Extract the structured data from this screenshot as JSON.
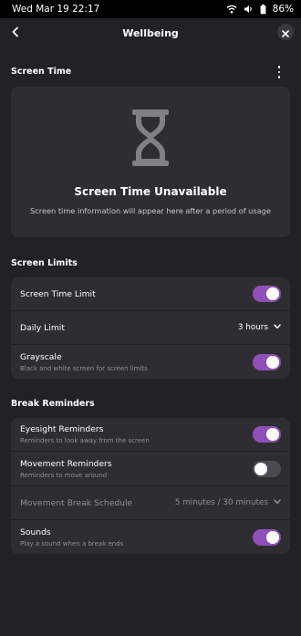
{
  "statusbar": {
    "datetime": "Wed Mar 19  22:17",
    "battery": "86%",
    "icons": [
      "wifi-icon",
      "volume-icon",
      "battery-icon"
    ]
  },
  "header": {
    "title": "Wellbeing",
    "back_icon": "chevron-left-icon",
    "close_icon": "close-icon"
  },
  "screen_time": {
    "section_title": "Screen Time",
    "menu_icon": "kebab-menu-icon",
    "placeholder_icon": "hourglass-icon",
    "placeholder_title": "Screen Time Unavailable",
    "placeholder_desc": "Screen time information will appear here after a period of usage"
  },
  "screen_limits": {
    "section_title": "Screen Limits",
    "screen_time_limit": {
      "label": "Screen Time Limit",
      "enabled": true
    },
    "daily_limit": {
      "label": "Daily Limit",
      "value": "3 hours"
    },
    "grayscale": {
      "label": "Grayscale",
      "sub": "Black and white screen for screen limits",
      "enabled": true
    }
  },
  "break_reminders": {
    "section_title": "Break Reminders",
    "eyesight": {
      "label": "Eyesight Reminders",
      "sub": "Reminders to look away from the screen",
      "enabled": true
    },
    "movement": {
      "label": "Movement Reminders",
      "sub": "Reminders to move around",
      "enabled": false
    },
    "schedule": {
      "label": "Movement Break Schedule",
      "value": "5 minutes / 30 minutes"
    },
    "sounds": {
      "label": "Sounds",
      "sub": "Play a sound when a break ends",
      "enabled": true
    }
  },
  "colors": {
    "background": "#222226",
    "card": "#2e2e32",
    "accent": "#8e50b6",
    "toggle_off": "#4a4a50",
    "dim_text": "#8e8e94"
  }
}
